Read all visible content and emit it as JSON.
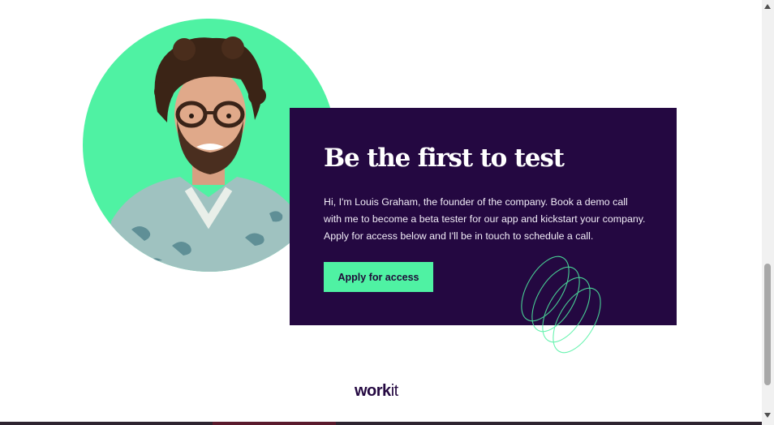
{
  "hero": {
    "title": "Be the first to test",
    "body": "Hi, I'm Louis Graham, the founder of the company. Book a demo call with me to become a beta tester for our app and kickstart your company. Apply for access below and I'll be in touch to schedule a call.",
    "cta_label": "Apply for access"
  },
  "footer": {
    "logo_bold": "work",
    "logo_light": "it"
  },
  "colors": {
    "accent_green": "#4ff2a3",
    "card_purple": "#240841",
    "ring_stroke": "#4ff2a3"
  },
  "icons": {
    "portrait": "founder-portrait",
    "rings": "decorative-rings-icon",
    "scroll_up": "scroll-up-arrow",
    "scroll_down": "scroll-down-arrow"
  }
}
